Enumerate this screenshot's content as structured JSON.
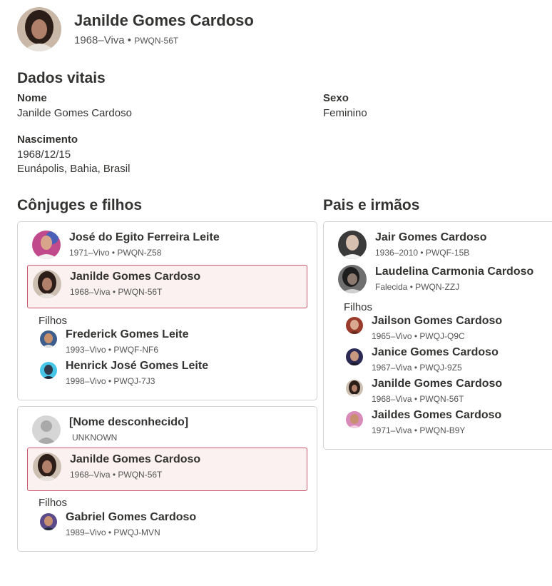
{
  "focus_person": {
    "name": "Janilde Gomes Cardoso",
    "lifespan": "1968–Viva",
    "separator": " • ",
    "pid": "PWQN-56T"
  },
  "vitals": {
    "title": "Dados vitais",
    "name_label": "Nome",
    "name_value": "Janilde Gomes Cardoso",
    "sex_label": "Sexo",
    "sex_value": "Feminino",
    "birth_label": "Nascimento",
    "birth_date": "1968/12/15",
    "birth_place": "Eunápolis, Bahia, Brasil"
  },
  "spouses": {
    "title": "Cônjuges e filhos",
    "children_label": "Filhos",
    "families": [
      {
        "spouse": {
          "name": "José do Egito Ferreira Leite",
          "desc": "1971–Vivo • PWQN-Z58"
        },
        "self": {
          "name": "Janilde Gomes Cardoso",
          "desc": "1968–Viva • PWQN-56T"
        },
        "children": [
          {
            "name": "Frederick Gomes Leite",
            "desc": "1993–Vivo • PWQF-NF6"
          },
          {
            "name": "Henrick José Gomes Leite",
            "desc": "1998–Vivo • PWQJ-7J3"
          }
        ]
      },
      {
        "spouse": {
          "name": "[Nome desconhecido]",
          "desc": "UNKNOWN"
        },
        "self": {
          "name": "Janilde Gomes Cardoso",
          "desc": "1968–Viva • PWQN-56T"
        },
        "children": [
          {
            "name": "Gabriel Gomes Cardoso",
            "desc": "1989–Vivo • PWQJ-MVN"
          }
        ]
      }
    ]
  },
  "parents": {
    "title": "Pais e irmãos",
    "children_label": "Filhos",
    "father": {
      "name": "Jair Gomes Cardoso",
      "desc": "1936–2010 • PWQF-15B"
    },
    "mother": {
      "name": "Laudelina Carmonia Cardoso",
      "desc": "Falecida • PWQN-ZZJ"
    },
    "siblings": [
      {
        "name": "Jailson Gomes Cardoso",
        "desc": "1965–Vivo • PWQJ-Q9C"
      },
      {
        "name": "Janice Gomes Cardoso",
        "desc": "1967–Viva • PWQJ-9Z5"
      },
      {
        "name": "Janilde Gomes Cardoso",
        "desc": "1968–Viva • PWQN-56T"
      },
      {
        "name": "Jaildes Gomes Cardoso",
        "desc": "1971–Viva • PWQN-B9Y"
      }
    ]
  }
}
